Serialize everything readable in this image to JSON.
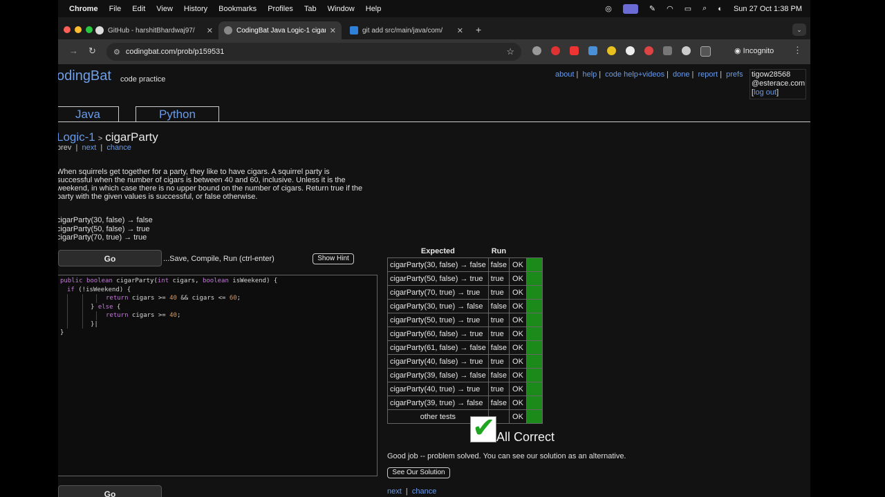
{
  "menubar": {
    "app": "Chrome",
    "items": [
      "File",
      "Edit",
      "View",
      "History",
      "Bookmarks",
      "Profiles",
      "Tab",
      "Window",
      "Help"
    ],
    "clock": "Sun 27 Oct  1:38 PM"
  },
  "tabs": [
    {
      "title": "GitHub - harshitBhardwaj97/",
      "favicon": "github-icon"
    },
    {
      "title": "CodingBat Java Logic-1 cigar",
      "favicon": "globe-icon"
    },
    {
      "title": "git add src/main/java/com/",
      "favicon": "vscode-icon"
    }
  ],
  "toolbar": {
    "url": "codingbat.com/prob/p159531",
    "incognito": "Incognito"
  },
  "site": {
    "logo": "odingBat",
    "logo_sub": "code practice",
    "links": [
      "about",
      "help",
      "code help+videos",
      "done",
      "report",
      "prefs"
    ],
    "user_line1": "tigow28568",
    "user_line2": "@esterace.com",
    "logout": "log out",
    "lang_java": "Java",
    "lang_python": "Python"
  },
  "problem": {
    "section": "Logic-1",
    "name": "cigarParty",
    "nav_prev": "prev",
    "nav_next": "next",
    "nav_chance": "chance",
    "description": "When squirrels get together for a party, they like to have cigars. A squirrel party is successful when the number of cigars is between 40 and 60, inclusive. Unless it is the weekend, in which case there is no upper bound on the number of cigars. Return true if the party with the given values is successful, or false otherwise.",
    "examples": [
      "cigarParty(30, false) → false",
      "cigarParty(50, false) → true",
      "cigarParty(70, true) → true"
    ],
    "go": "Go",
    "go_hint": "...Save, Compile, Run (ctrl-enter)",
    "show_hint": "Show Hint"
  },
  "code": [
    "public boolean cigarParty(int cigars, boolean isWeekend) {",
    "  if (!isWeekend) {",
    "    return cigars >= 40 && cigars <= 60;",
    "  } else {",
    "    return cigars >= 40;",
    "  }",
    "}"
  ],
  "results": {
    "header_expected": "Expected",
    "header_run": "Run",
    "rows": [
      {
        "expected": "cigarParty(30, false) → false",
        "run": "false",
        "status": "OK"
      },
      {
        "expected": "cigarParty(50, false) → true",
        "run": "true",
        "status": "OK"
      },
      {
        "expected": "cigarParty(70, true) → true",
        "run": "true",
        "status": "OK"
      },
      {
        "expected": "cigarParty(30, true) → false",
        "run": "false",
        "status": "OK"
      },
      {
        "expected": "cigarParty(50, true) → true",
        "run": "true",
        "status": "OK"
      },
      {
        "expected": "cigarParty(60, false) → true",
        "run": "true",
        "status": "OK"
      },
      {
        "expected": "cigarParty(61, false) → false",
        "run": "false",
        "status": "OK"
      },
      {
        "expected": "cigarParty(40, false) → true",
        "run": "true",
        "status": "OK"
      },
      {
        "expected": "cigarParty(39, false) → false",
        "run": "false",
        "status": "OK"
      },
      {
        "expected": "cigarParty(40, true) → true",
        "run": "true",
        "status": "OK"
      },
      {
        "expected": "cigarParty(39, true) → false",
        "run": "false",
        "status": "OK"
      }
    ],
    "other": {
      "expected": "other tests",
      "status": "OK"
    },
    "pass_color": "#1b8a1b"
  },
  "outcome": {
    "all_correct": "All Correct",
    "good_job": "Good job -- problem solved. You can see our solution as an alternative.",
    "see_solution": "See Our Solution",
    "next": "next",
    "chance": "chance"
  }
}
